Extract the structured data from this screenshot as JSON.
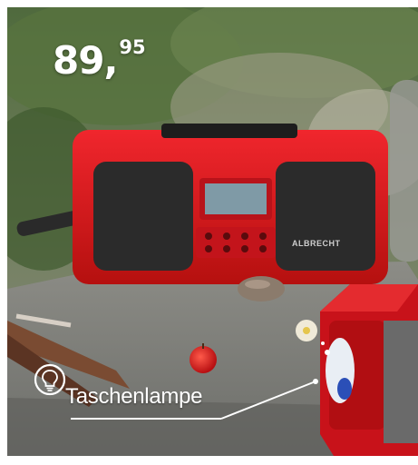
{
  "price": {
    "whole": "89",
    "comma": ",",
    "cents": "95"
  },
  "callout": {
    "label": "Taschenlampe",
    "icon": "lightbulb-icon"
  },
  "product": {
    "brand": "ALBRECHT",
    "color": "#e3161d"
  }
}
